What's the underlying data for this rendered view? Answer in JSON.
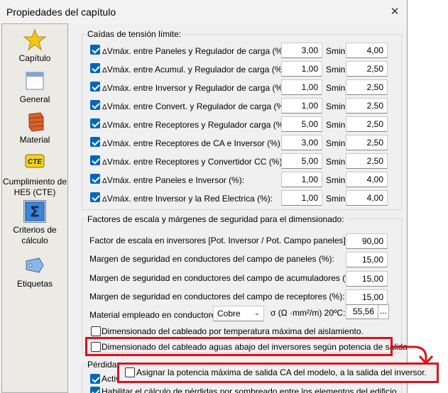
{
  "window": {
    "title": "Propiedades del capítulo",
    "close_glyph": "✕"
  },
  "sidebar": {
    "items": [
      {
        "label": "Capítulo",
        "icon": "star-icon"
      },
      {
        "label": "General",
        "icon": "window-icon"
      },
      {
        "label": "Material",
        "icon": "brick-icon"
      },
      {
        "label": "Cumplimiento de HE5 (CTE)",
        "icon": "cte-icon"
      },
      {
        "label": "Criterios de cálculo",
        "icon": "sigma-icon",
        "active": true
      },
      {
        "label": "Etiquetas",
        "icon": "tag-icon"
      }
    ]
  },
  "caidas": {
    "legend": "Caídas de tensión límite:",
    "smin_label": "Smin:",
    "rows": [
      {
        "label": "Vmáx. entre Paneles y Regulador de carga (%):",
        "value": "3,00",
        "smin": "4,00"
      },
      {
        "label": "Vmáx. entre Acumul. y Regulador de carga (%):",
        "value": "1,00",
        "smin": "2,50"
      },
      {
        "label": "Vmáx. entre Inversor y Regulador de carga (%):",
        "value": "1,00",
        "smin": "2,50"
      },
      {
        "label": "Vmáx. entre Convert. y Regulador de carga (%):",
        "value": "1,00",
        "smin": "2,50"
      },
      {
        "label": "Vmáx. entre Receptores y Regulador carga (%):",
        "value": "5,00",
        "smin": "2,50"
      },
      {
        "label": "Vmáx. entre Receptores de CA e Inversor (%):",
        "value": "3,00",
        "smin": "2,50"
      },
      {
        "label": "Vmáx. entre Receptores y Convertidor CC (%):",
        "value": "5,00",
        "smin": "2,50"
      },
      {
        "label": "Vmáx. entre Paneles e Inversor  (%):",
        "value": "1,00",
        "smin": "4,00"
      },
      {
        "label": "Vmáx. entre Inversor y la Red Electrica (%):",
        "value": "1,00",
        "smin": "4,00"
      }
    ]
  },
  "factores": {
    "legend": "Factores de escala y márgenes de seguridad para el dimensionado:",
    "rows": [
      {
        "label": "Factor de escala en inversores  [Pot. Inversor / Pot. Campo paneles] (%):",
        "value": "90,00"
      },
      {
        "label": "Margen de seguridad en conductores del campo de paneles (%):",
        "value": "15,00"
      },
      {
        "label": "Margen de seguridad en conductores del campo de acumuladores (%):",
        "value": "15,00"
      },
      {
        "label": "Margen de seguridad en conductores del campo de receptores (%):",
        "value": "15,00"
      }
    ],
    "material_label": "Material empleado en conductores",
    "material_value": "Cobre",
    "sigma_label": "σ (Ω ·mm²/m) 20ºC:",
    "sigma_value": "55,56",
    "dots": "...",
    "chk_temp": "Dimensionado del cableado por temperatura máxima del aislamiento.",
    "chk_aguas": "Dimensionado del cableado aguas abajo del inversores según potencia de salida."
  },
  "perdidas": {
    "legend": "Pérdidas",
    "chk_activ": "Activ",
    "chk_asignar": "Asignar la potencia máxima de salida CA del modelo, a la salida del inversor.",
    "chk_habilitar": "Habilitar el cálculo de pérdidas por sombreado entre los elementos del edificio"
  },
  "delta_symbol": "Δ",
  "highlight_color": "#e0101c"
}
